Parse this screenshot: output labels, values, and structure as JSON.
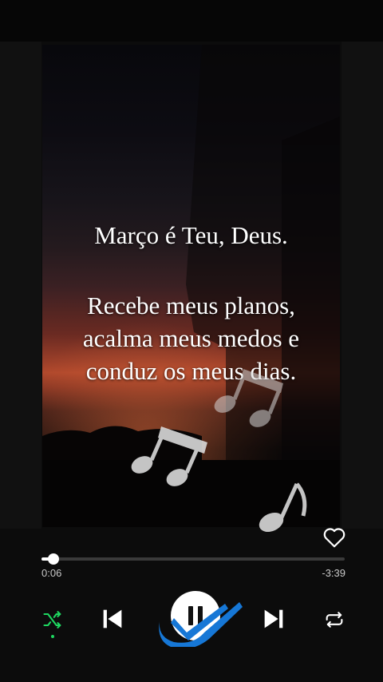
{
  "lyrics": {
    "line1": "Março é Teu, Deus.",
    "line2": "Recebe meus planos,",
    "line3": "acalma meus medos e",
    "line4": "conduz os meus dias."
  },
  "player": {
    "elapsed": "0:06",
    "remaining": "-3:39",
    "progress_fraction": 0.04,
    "is_playing": true,
    "shuffle_on": true,
    "liked": false
  },
  "icons": {
    "like": "heart-icon",
    "shuffle": "shuffle-icon",
    "previous": "skip-previous-icon",
    "play_pause": "pause-icon",
    "next": "skip-next-icon",
    "repeat": "repeat-icon",
    "overlay": "music-notes-icon"
  },
  "colors": {
    "background": "#0c0c0c",
    "accent": "#1ed760",
    "badge": "#1677d6",
    "text": "#ffffff",
    "subtext": "#c8c8c8"
  }
}
